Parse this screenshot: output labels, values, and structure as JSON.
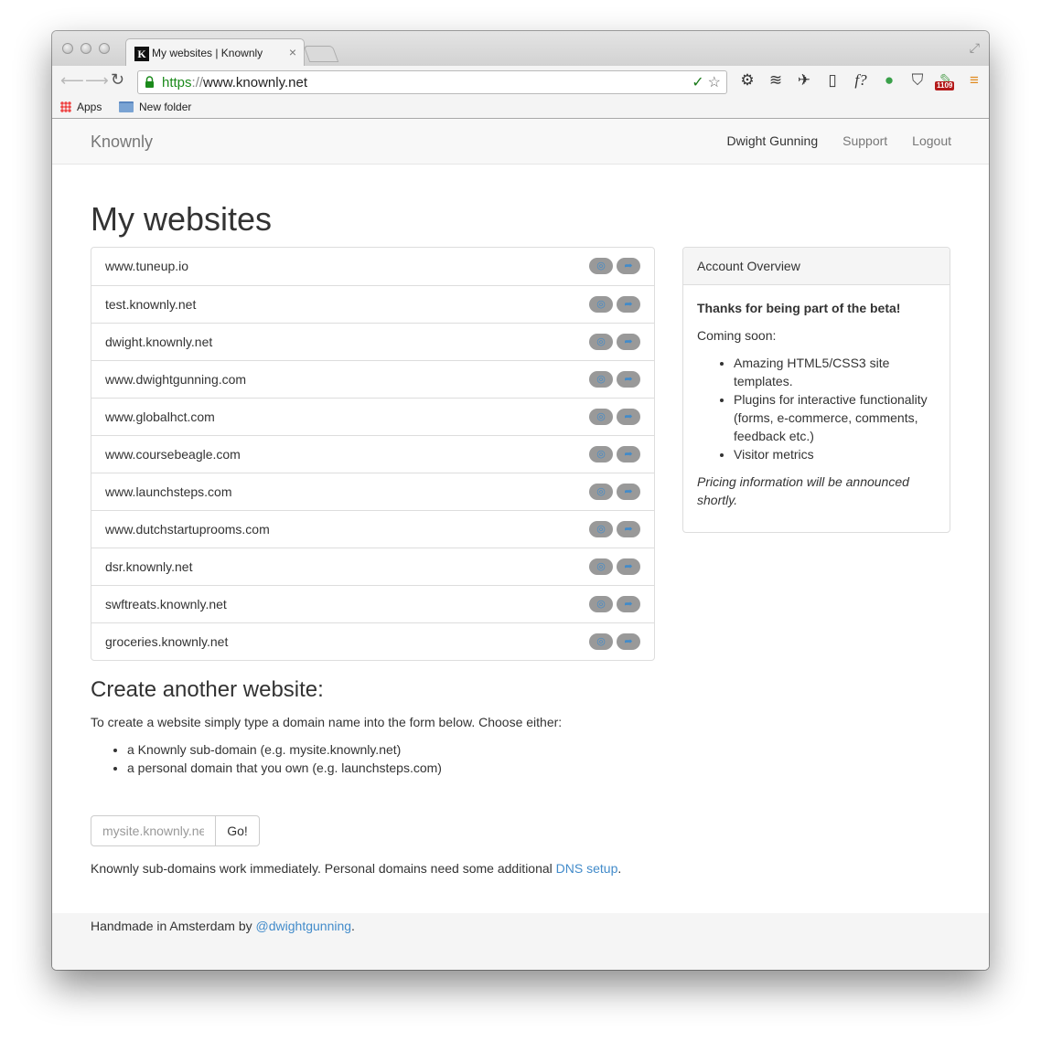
{
  "browser": {
    "tab_title": "My websites | Knownly",
    "tab_close": "×",
    "favicon_letter": "K",
    "url_scheme": "https",
    "url_sep": "://",
    "url_host": "www.knownly.net",
    "bookmarks": [
      "Apps",
      "New folder"
    ],
    "extension_badge": "1109"
  },
  "navbar": {
    "brand": "Knownly",
    "links": [
      "Dwight Gunning",
      "Support",
      "Logout"
    ]
  },
  "page_title": "My websites",
  "websites": [
    "www.tuneup.io",
    "test.knownly.net",
    "dwight.knownly.net",
    "www.dwightgunning.com",
    "www.globalhct.com",
    "www.coursebeagle.com",
    "www.launchsteps.com",
    "www.dutchstartuprooms.com",
    "dsr.knownly.net",
    "swftreats.knownly.net",
    "groceries.knownly.net"
  ],
  "account": {
    "heading": "Account Overview",
    "thanks": "Thanks for being part of the beta!",
    "coming_soon": "Coming soon:",
    "features": [
      "Amazing HTML5/CSS3 site templates.",
      "Plugins for interactive functionality (forms, e-commerce, comments, feedback etc.)",
      "Visitor metrics"
    ],
    "pricing": "Pricing information will be announced shortly."
  },
  "create": {
    "heading": "Create another website:",
    "intro": "To create a website simply type a domain name into the form below. Choose either:",
    "options": [
      "a Knownly sub-domain (e.g. mysite.knownly.net)",
      "a personal domain that you own (e.g. launchsteps.com)"
    ],
    "input_placeholder": "mysite.knownly.net",
    "input_value": "",
    "go_label": "Go!",
    "note_prefix": "Knownly sub-domains work immediately. Personal domains need some additional ",
    "note_link": "DNS setup",
    "note_suffix": "."
  },
  "footer": {
    "prefix": "Handmade in Amsterdam by ",
    "link": "@dwightgunning",
    "suffix": "."
  },
  "colors": {
    "link": "#428bca",
    "row_button": "#999999",
    "secure_green": "#1b8a1b",
    "navbar_bg": "#f8f8f8"
  }
}
